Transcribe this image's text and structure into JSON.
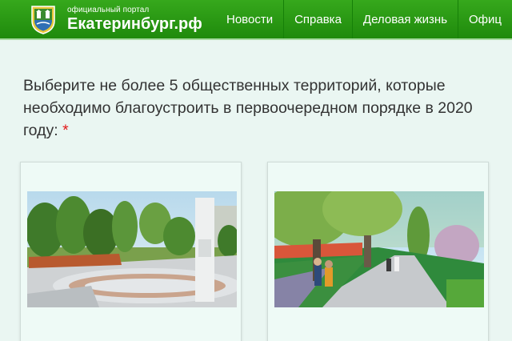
{
  "header": {
    "logo_icon": "city-crest-icon",
    "portal_label": "официальный портал",
    "site_name": "Екатеринбург.рф",
    "nav": [
      {
        "label": "Новости"
      },
      {
        "label": "Справка"
      },
      {
        "label": "Деловая жизнь"
      },
      {
        "label": "Офиц"
      }
    ]
  },
  "poll": {
    "question": "Выберите не более 5 общественных территорий, которые необходимо благоустроить в первоочередном порядке в 2020 году:",
    "required_mark": "*"
  },
  "options": [
    {
      "image": "park-square-rendering"
    },
    {
      "image": "tree-lined-walkway-rendering"
    }
  ],
  "colors": {
    "header_green": "#2a9a14",
    "page_background": "#eaf6f2",
    "required_red": "#e21b1b"
  }
}
